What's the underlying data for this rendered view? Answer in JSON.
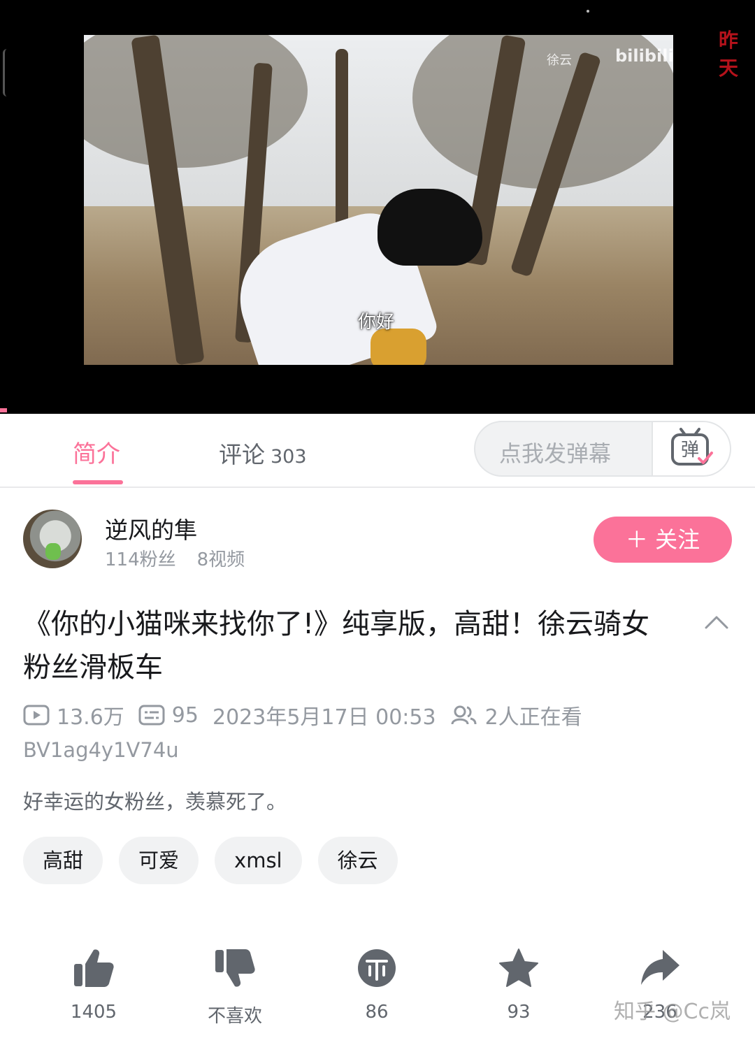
{
  "video": {
    "subtitle": "你好",
    "watermark_uploader": "徐云",
    "watermark_logo": "bilibili",
    "corner_text": "昨天"
  },
  "tabs": {
    "intro": "简介",
    "comments": "评论",
    "comments_count": "303",
    "danmaku_placeholder": "点我发弹幕",
    "danmaku_button_glyph": "弹"
  },
  "uploader": {
    "name": "逆风的隼",
    "fans": "114粉丝",
    "videos": "8视频",
    "follow_label": "＋ 关注"
  },
  "video_info": {
    "title": "《你的小猫咪来找你了!》纯享版，高甜！徐云骑女粉丝滑板车",
    "views": "13.6万",
    "danmaku_count": "95",
    "datetime": "2023年5月17日 00:53",
    "watching": "2人正在看",
    "bvid": "BV1ag4y1V74u",
    "description": "好幸运的女粉丝，羡慕死了。"
  },
  "tags": [
    "高甜",
    "可爱",
    "xmsl",
    "徐云"
  ],
  "actions": {
    "like": "1405",
    "dislike": "不喜欢",
    "coin": "86",
    "favorite": "93",
    "share": "236"
  },
  "watermark": "知乎 @Cc岚",
  "colors": {
    "accent": "#fb7299",
    "text": "#18191c",
    "muted": "#9499a0"
  }
}
